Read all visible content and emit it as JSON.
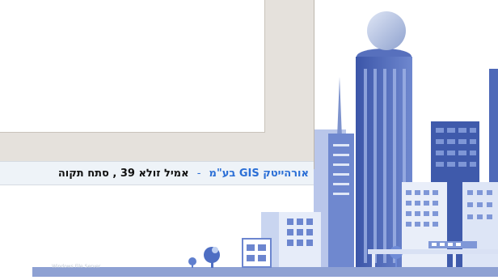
{
  "status_bar": {
    "company_name": "אורהייטק GIS בע\"מ",
    "separator": "-",
    "address": "אמיל זולא 39 , סתח תקוה"
  },
  "footer": {
    "watermark_text": "Windows File Server"
  },
  "colors": {
    "accent_blue": "#2b6fd6",
    "panel_bg": "#e5e1dc",
    "skyline_blue": "#4a67b5"
  }
}
